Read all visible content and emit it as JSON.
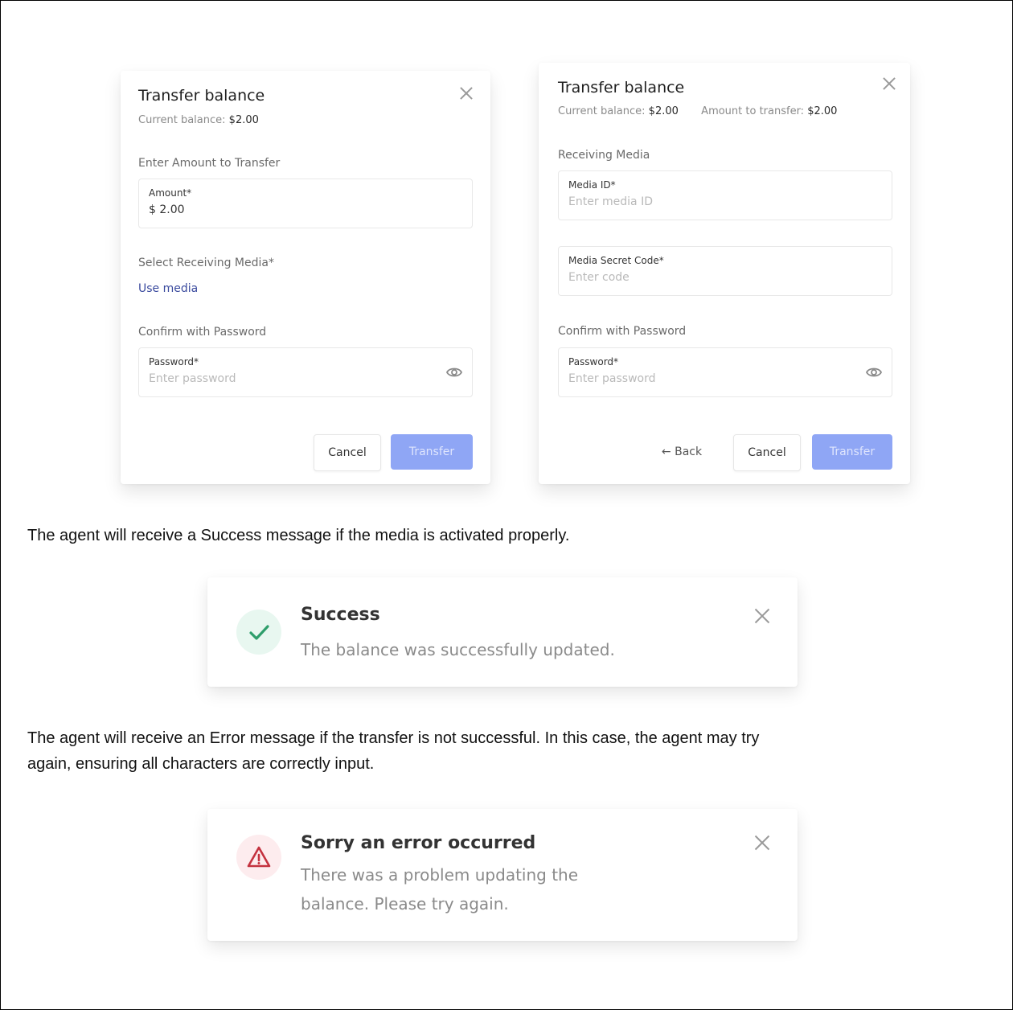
{
  "dialog1": {
    "title": "Transfer balance",
    "balance_label": "Current balance:",
    "balance_value": "$2.00",
    "section_amount": "Enter Amount to Transfer",
    "amount_label": "Amount*",
    "amount_value": "$ 2.00",
    "section_media": "Select Receiving Media*",
    "use_media_link": "Use media",
    "section_password": "Confirm with Password",
    "password_label": "Password*",
    "password_placeholder": "Enter password",
    "cancel_label": "Cancel",
    "transfer_label": "Transfer"
  },
  "dialog2": {
    "title": "Transfer balance",
    "balance_label": "Current balance:",
    "balance_value": "$2.00",
    "amount_label": "Amount to transfer:",
    "amount_value": "$2.00",
    "section_media": "Receiving Media",
    "media_id_label": "Media ID*",
    "media_id_placeholder": "Enter media ID",
    "secret_label": "Media Secret Code*",
    "secret_placeholder": "Enter code",
    "section_password": "Confirm with Password",
    "password_label": "Password*",
    "password_placeholder": "Enter password",
    "back_label": "Back",
    "cancel_label": "Cancel",
    "transfer_label": "Transfer"
  },
  "text1": "The agent will receive a Success message if the media is activated properly.",
  "success_toast": {
    "title": "Success",
    "message": "The balance was successfully updated."
  },
  "text2_line1": "The agent will receive an Error message if the transfer  is not successful. In this case, the agent may try",
  "text2_line2": "again, ensuring all characters are correctly input.",
  "error_toast": {
    "title": "Sorry an error occurred",
    "message_line1": "There was a problem updating the",
    "message_line2": "balance. Please try again."
  },
  "icons": {
    "close": "close-icon",
    "eye": "eye-icon",
    "arrow": "arrow-left-icon",
    "check": "check-icon",
    "warning": "warning-icon"
  },
  "colors": {
    "primary_button": "#8fa6f5",
    "link": "#3a4a9e",
    "success_bg": "#e8f7f0",
    "success_icon": "#2e9e6b",
    "error_bg": "#fdecee",
    "error_icon": "#c4323f"
  }
}
